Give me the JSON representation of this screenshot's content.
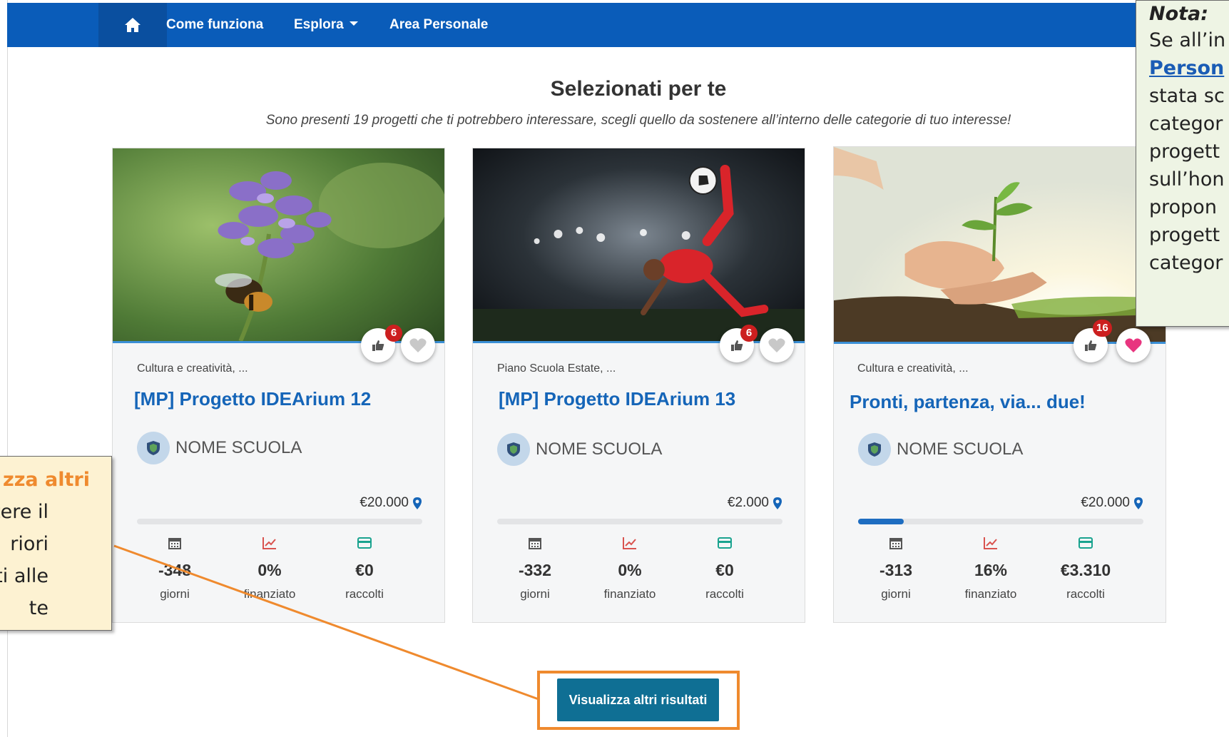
{
  "nav": {
    "home_icon": "home-icon",
    "items": [
      {
        "label": "Come funziona"
      },
      {
        "label": "Esplora",
        "has_dropdown": true
      },
      {
        "label": "Area Personale"
      }
    ]
  },
  "section": {
    "title": "Selezionati per te",
    "subtitle": "Sono presenti 19 progetti che ti potrebbero interessare, scegli quello da sostenere all’interno delle categorie di tuo interesse!"
  },
  "cards": [
    {
      "image": "bee-on-flower",
      "likes": "6",
      "favorited": false,
      "category": "Cultura e creatività, ...",
      "title": "[MP] Progetto IDEArium 12",
      "school": "NOME SCUOLA",
      "goal": "€20.000",
      "progress": 0,
      "stats": {
        "days": "-348",
        "days_label": "giorni",
        "funded": "0%",
        "funded_label": "finanziato",
        "raised": "€0",
        "raised_label": "raccolti"
      }
    },
    {
      "image": "soccer-player-bicycle-kick",
      "likes": "6",
      "favorited": false,
      "category": "Piano Scuola Estate, ...",
      "title": "[MP] Progetto IDEArium 13",
      "school": "NOME SCUOLA",
      "goal": "€2.000",
      "progress": 0,
      "stats": {
        "days": "-332",
        "days_label": "giorni",
        "funded": "0%",
        "funded_label": "finanziato",
        "raised": "€0",
        "raised_label": "raccolti"
      }
    },
    {
      "image": "hands-holding-seedling",
      "likes": "16",
      "favorited": true,
      "category": "Cultura e creatività, ...",
      "title": "Pronti, partenza, via... due!",
      "school": "NOME SCUOLA",
      "goal": "€20.000",
      "progress": 0.16,
      "stats": {
        "days": "-313",
        "days_label": "giorni",
        "funded": "16%",
        "funded_label": "finanziato",
        "raised": "€3.310",
        "raised_label": "raccolti"
      }
    }
  ],
  "more_button": {
    "label": "Visualizza altri risultati"
  },
  "note_callout": {
    "title": "Nota:",
    "lines": [
      "Se all’in",
      "Person",
      "stata sc",
      "categor",
      "progett",
      "sull’hon",
      "propon",
      "progett",
      "categor"
    ]
  },
  "left_callout": {
    "lines": [
      "zza altri",
      "ttere il",
      "riori",
      "nti alle",
      "te"
    ]
  },
  "colors": {
    "navbar": "#0a5cb9",
    "title_link": "#1565b8",
    "button": "#0f6f94",
    "highlight_orange": "#ef8a2e",
    "heart_active": "#e8357f"
  }
}
